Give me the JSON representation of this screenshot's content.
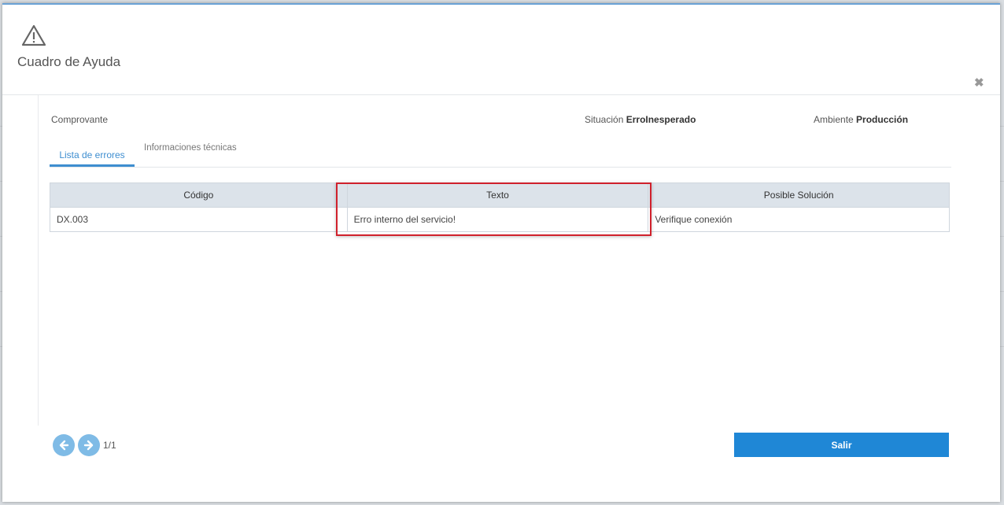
{
  "dialog": {
    "title": "Cuadro de Ayuda"
  },
  "meta": {
    "comprobante_label": "Comprovante",
    "situacion_label": "Situación",
    "situacion_value": "ErroInesperado",
    "ambiente_label": "Ambiente",
    "ambiente_value": "Producción"
  },
  "tabs": [
    {
      "label": "Lista de errores",
      "active": true
    },
    {
      "label": "Informaciones técnicas",
      "active": false
    }
  ],
  "table": {
    "headers": [
      "Código",
      "Texto",
      "Posible Solución"
    ],
    "rows": [
      [
        "DX.003",
        "Erro interno del servicio!",
        "Verifique conexión"
      ]
    ]
  },
  "pager": {
    "text": "1/1"
  },
  "actions": {
    "exit_label": "Salir"
  },
  "colors": {
    "accent": "#3e8ed0",
    "button": "#1f87d6",
    "highlight": "#d0212c"
  },
  "icons": [
    "warning-icon",
    "close-icon",
    "arrow-left-icon",
    "arrow-right-icon"
  ]
}
